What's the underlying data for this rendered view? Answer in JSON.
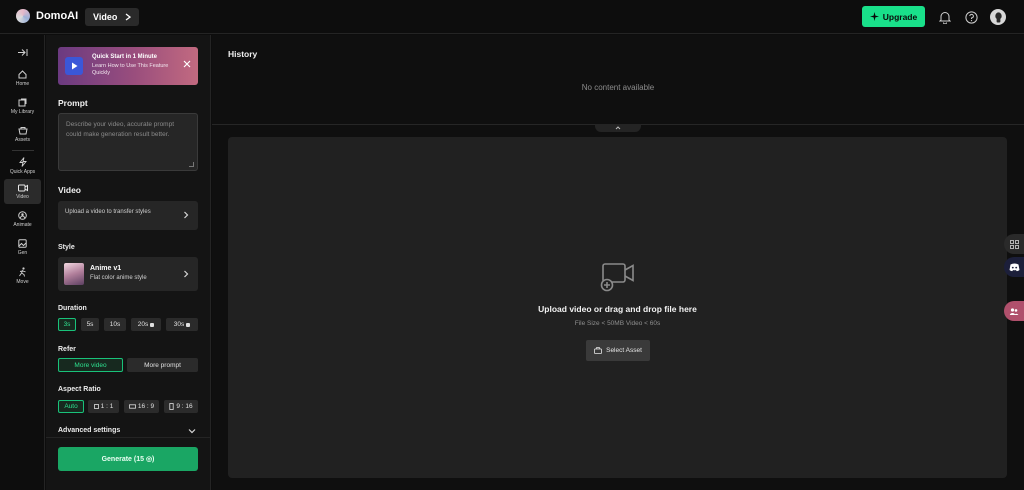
{
  "app": {
    "name": "DomoAI",
    "breadcrumb": "Video"
  },
  "header": {
    "upgrade_label": "Upgrade"
  },
  "leftnav": {
    "items": [
      {
        "label": "Home",
        "icon": "home-icon"
      },
      {
        "label": "My Library",
        "icon": "library-icon"
      },
      {
        "label": "Assets",
        "icon": "assets-icon"
      },
      {
        "label": "Quick Apps",
        "icon": "quick-apps-icon"
      },
      {
        "label": "Video",
        "icon": "video-icon",
        "active": true
      },
      {
        "label": "Animate",
        "icon": "animate-icon"
      },
      {
        "label": "Gen",
        "icon": "gen-icon"
      },
      {
        "label": "Move",
        "icon": "move-icon"
      }
    ]
  },
  "promo": {
    "title": "Quick Start in 1 Minute",
    "subtitle": "Learn How to Use This Feature Quickly"
  },
  "prompt": {
    "title": "Prompt",
    "placeholder": "Describe your video, accurate prompt could make generation result better."
  },
  "video": {
    "title": "Video",
    "upload_text": "Upload a video to transfer styles"
  },
  "style": {
    "title": "Style",
    "name": "Anime v1",
    "description": "Flat color anime style"
  },
  "duration": {
    "title": "Duration",
    "options": [
      {
        "label": "3s",
        "selected": true,
        "locked": false
      },
      {
        "label": "5s",
        "selected": false,
        "locked": false
      },
      {
        "label": "10s",
        "selected": false,
        "locked": false
      },
      {
        "label": "20s",
        "selected": false,
        "locked": true
      },
      {
        "label": "30s",
        "selected": false,
        "locked": true
      }
    ]
  },
  "refer": {
    "title": "Refer",
    "options": [
      {
        "label": "More video",
        "selected": true
      },
      {
        "label": "More prompt",
        "selected": false
      }
    ]
  },
  "aspect": {
    "title": "Aspect Ratio",
    "options": [
      {
        "label": "Auto",
        "selected": true
      },
      {
        "label": "1 : 1",
        "selected": false
      },
      {
        "label": "16 : 9",
        "selected": false
      },
      {
        "label": "9 : 16",
        "selected": false
      }
    ]
  },
  "advanced": {
    "title": "Advanced settings"
  },
  "generate": {
    "label": "Generate (15 ◎)"
  },
  "history": {
    "title": "History",
    "empty_text": "No content available"
  },
  "dropzone": {
    "title": "Upload video or drag and drop file here",
    "meta": "File Size < 50MB   Video < 60s",
    "select_label": "Select Asset"
  },
  "colors": {
    "accent": "#19e08a",
    "generate": "#1aa664",
    "background": "#0d0d0d",
    "panel": "#141414",
    "card": "#262626"
  }
}
